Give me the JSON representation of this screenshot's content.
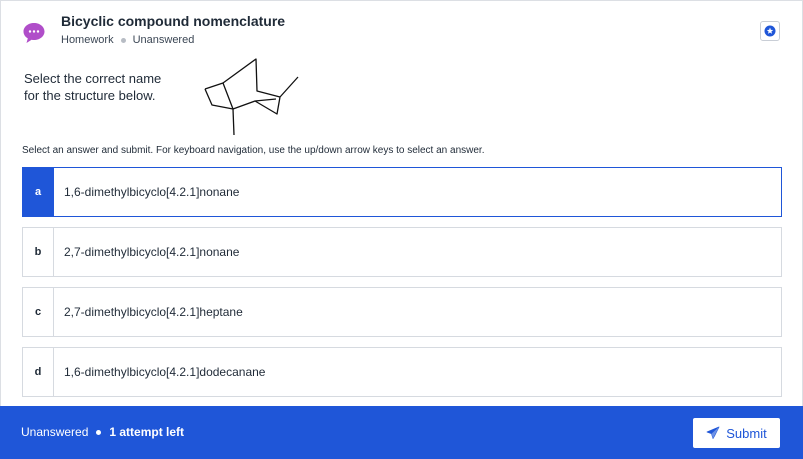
{
  "header": {
    "title": "Bicyclic compound nomenclature",
    "category": "Homework",
    "status": "Unanswered"
  },
  "question": {
    "prompt": "Select the correct name for the structure below."
  },
  "instructions": "Select an answer and submit. For keyboard navigation, use the up/down arrow keys to select an answer.",
  "options": [
    {
      "letter": "a",
      "text": "1,6-dimethylbicyclo[4.2.1]nonane",
      "selected": true
    },
    {
      "letter": "b",
      "text": "2,7-dimethylbicyclo[4.2.1]nonane",
      "selected": false
    },
    {
      "letter": "c",
      "text": "2,7-dimethylbicyclo[4.2.1]heptane",
      "selected": false
    },
    {
      "letter": "d",
      "text": "1,6-dimethylbicyclo[4.2.1]dodecanane",
      "selected": false
    }
  ],
  "footer": {
    "status": "Unanswered",
    "attempts": "1 attempt left",
    "submit_label": "Submit"
  },
  "colors": {
    "accent": "#1f56d8",
    "chat_icon": "#b04ec9"
  },
  "icons": {
    "chat": "chat-bubble-icon",
    "bookmark": "star-bookmark-icon",
    "submit": "paper-plane-icon"
  }
}
